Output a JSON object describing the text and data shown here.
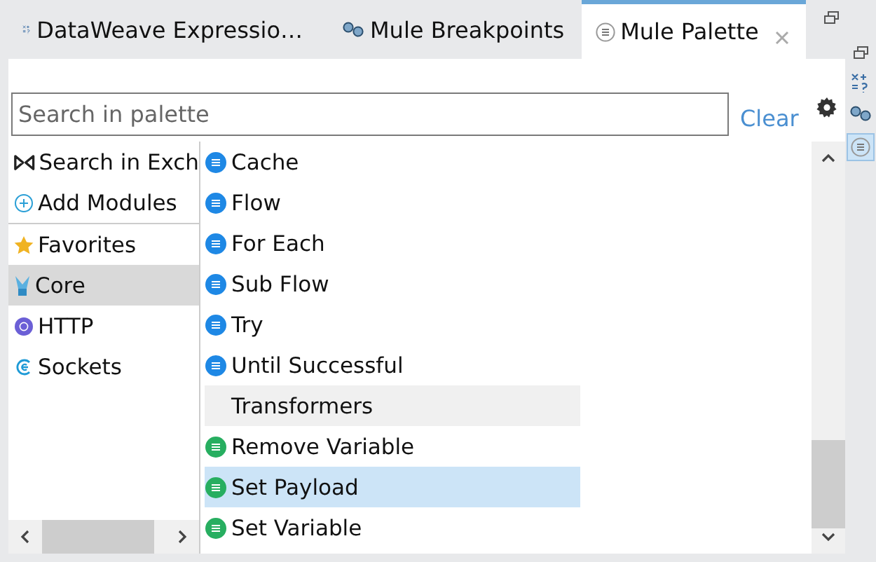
{
  "tabs": [
    {
      "label": "DataWeave Expressio…",
      "kind": "dataweave",
      "selected": false
    },
    {
      "label": "Mule Breakpoints",
      "kind": "breakpoints",
      "selected": false
    },
    {
      "label": "Mule Palette",
      "kind": "palette",
      "selected": true
    }
  ],
  "search": {
    "placeholder": "Search in palette"
  },
  "clear_link": "Clear",
  "sidebar": {
    "items": [
      {
        "label": "Search in Exch",
        "kind": "exchange",
        "selected": false
      },
      {
        "label": "Add Modules",
        "kind": "add",
        "selected": false
      },
      {
        "label": "Favorites",
        "kind": "favorites",
        "selected": false
      },
      {
        "label": "Core",
        "kind": "core",
        "selected": true
      },
      {
        "label": "HTTP",
        "kind": "http",
        "selected": false
      },
      {
        "label": "Sockets",
        "kind": "sockets",
        "selected": false
      }
    ]
  },
  "components": [
    {
      "kind": "item",
      "label": "Cache",
      "color": "#1e88e5",
      "selected": false
    },
    {
      "kind": "item",
      "label": "Flow",
      "color": "#1e88e5",
      "selected": false
    },
    {
      "kind": "item",
      "label": "For Each",
      "color": "#1e88e5",
      "selected": false
    },
    {
      "kind": "item",
      "label": "Sub Flow",
      "color": "#1e88e5",
      "selected": false
    },
    {
      "kind": "item",
      "label": "Try",
      "color": "#1e88e5",
      "selected": false
    },
    {
      "kind": "item",
      "label": "Until Successful",
      "color": "#1e88e5",
      "selected": false
    },
    {
      "kind": "category",
      "label": "Transformers"
    },
    {
      "kind": "item",
      "label": "Remove Variable",
      "color": "#27ae60",
      "selected": false
    },
    {
      "kind": "item",
      "label": "Set Payload",
      "color": "#27ae60",
      "selected": true
    },
    {
      "kind": "item",
      "label": "Set Variable",
      "color": "#27ae60",
      "selected": false
    }
  ]
}
